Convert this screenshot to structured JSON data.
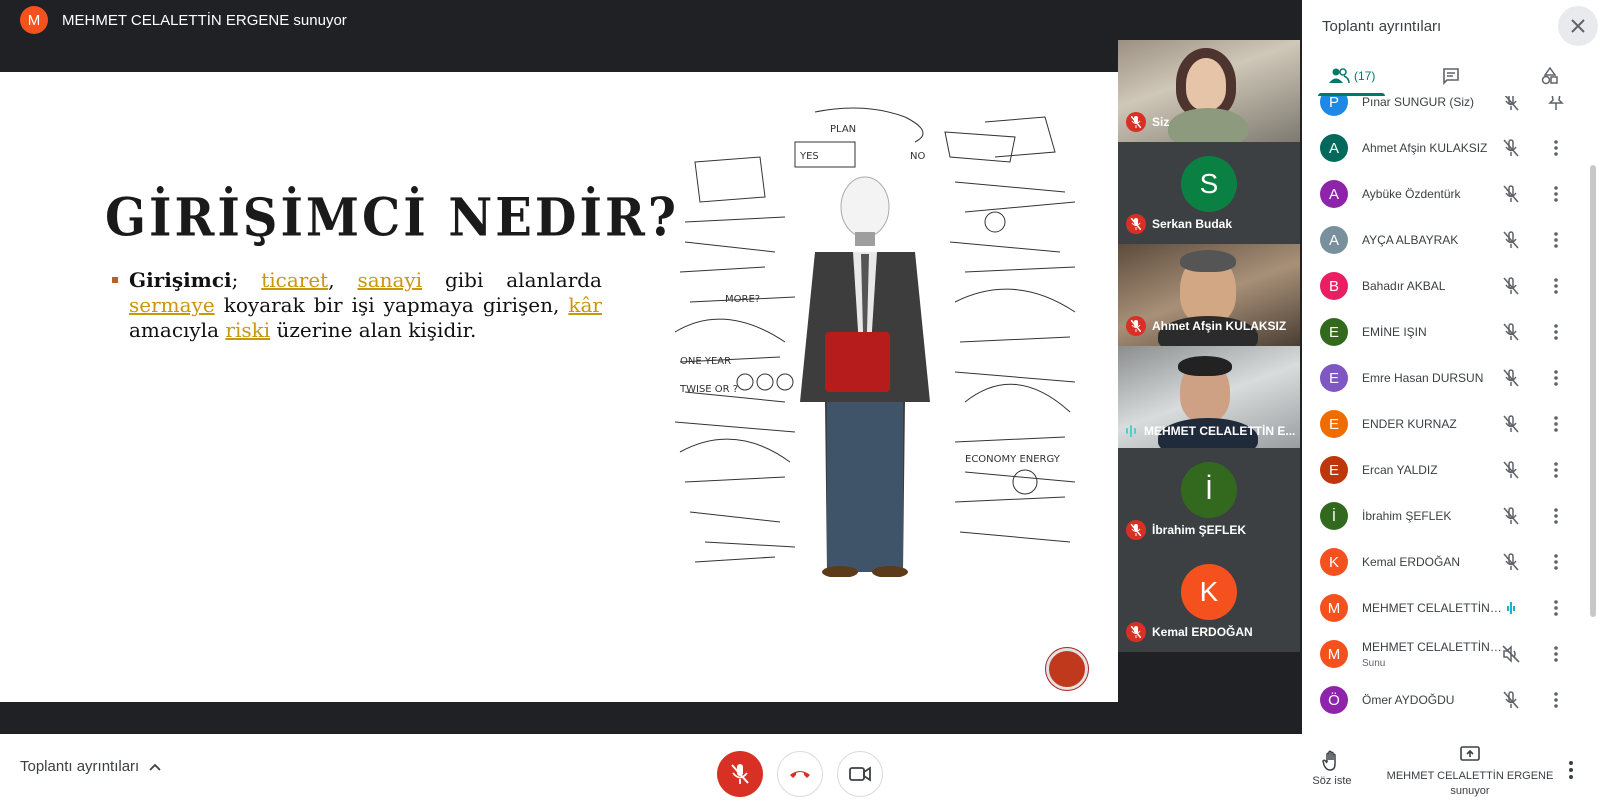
{
  "presenter_bar": {
    "avatar_letter": "M",
    "title": "MEHMET CELALETTİN ERGENE sunuyor"
  },
  "slide": {
    "title": "GİRİŞİMCİ NEDİR?",
    "term": "Girişimci",
    "p1": "; ",
    "link1": "ticaret",
    "p2": ", ",
    "link2": "sanayi",
    "p3": " gibi alanlarda ",
    "link3": "sermaye",
    "p4": " koyarak bir işi yapmaya girişen, ",
    "link4": "kâr",
    "p5": " amacıyla ",
    "link5": "riski",
    "p6": " üzerine alan kişidir.",
    "illustration_labels": [
      "PLAN",
      "YES",
      "NO",
      "ONE YEAR",
      "TWISE OR ?",
      "ECONOMY ENERGY",
      "MORE?"
    ]
  },
  "tiles": [
    {
      "label": "Siz",
      "type": "video"
    },
    {
      "label": "Serkan Budak",
      "avatar": "S",
      "color": "#0b8043"
    },
    {
      "label": "Ahmet Afşin KULAKSIZ",
      "type": "video"
    },
    {
      "label": "MEHMET CELALETTİN E...",
      "type": "video"
    },
    {
      "label": "İbrahim ŞEFLEK",
      "avatar": "İ",
      "color": "#33691e"
    },
    {
      "label": "Kemal ERDOĞAN",
      "avatar": "K",
      "color": "#f4511e"
    }
  ],
  "panel": {
    "title": "Toplantı ayrıntıları",
    "people_count": "(17)",
    "participants": [
      {
        "letter": "P",
        "name": "Pınar SUNGUR (Siz)",
        "color": "#1e88e5",
        "action": "pin"
      },
      {
        "letter": "A",
        "name": "Ahmet Afşin KULAKSIZ",
        "color": "#00695c"
      },
      {
        "letter": "A",
        "name": "Aybüke Özdentürk",
        "color": "#8e24aa"
      },
      {
        "letter": "A",
        "name": "AYÇA ALBAYRAK",
        "color": "#78909c"
      },
      {
        "letter": "B",
        "name": "Bahadır AKBAL",
        "color": "#e91e63"
      },
      {
        "letter": "E",
        "name": "EMİNE IŞIN",
        "color": "#33691e"
      },
      {
        "letter": "E",
        "name": "Emre Hasan DURSUN",
        "color": "#7e57c2"
      },
      {
        "letter": "E",
        "name": "ENDER KURNAZ",
        "color": "#ef6c00"
      },
      {
        "letter": "E",
        "name": "Ercan YALDIZ",
        "color": "#bf360c"
      },
      {
        "letter": "İ",
        "name": "İbrahim ŞEFLEK",
        "color": "#33691e"
      },
      {
        "letter": "K",
        "name": "Kemal ERDOĞAN",
        "color": "#f4511e"
      },
      {
        "letter": "M",
        "name": "MEHMET CELALETTİN E...",
        "color": "#f4511e",
        "speaking": true
      },
      {
        "letter": "M",
        "name": "MEHMET CELALETTİN E...",
        "sub": "Sunu",
        "color": "#f4511e",
        "presentation": true
      },
      {
        "letter": "Ö",
        "name": "Ömer AYDOĞDU",
        "color": "#8e24aa"
      }
    ]
  },
  "bottom": {
    "details_label": "Toplantı ayrıntıları",
    "raise_hand": "Söz iste",
    "presenter_line1": "MEHMET CELALETTİN ERGENE",
    "presenter_line2": "sunuyor"
  }
}
